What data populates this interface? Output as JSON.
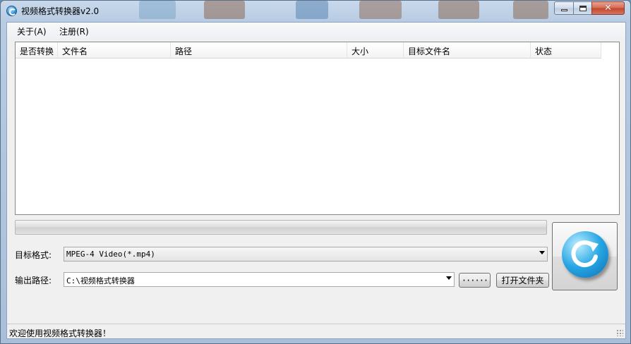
{
  "window": {
    "title": "视频格式转换器v2.0",
    "minimize_label": "",
    "maximize_label": "",
    "close_label": "✕"
  },
  "menu": {
    "about": "关于(A)",
    "register": "注册(R)"
  },
  "file_list": {
    "columns": [
      "是否转换",
      "文件名",
      "路径",
      "大小",
      "目标文件名",
      "状态"
    ],
    "rows": []
  },
  "progress": {
    "value": 0
  },
  "target_format": {
    "label": "目标格式:",
    "value": "MPEG-4 Video(*.mp4)"
  },
  "output_path": {
    "label": "输出路径:",
    "value": "C:\\视频格式转换器"
  },
  "buttons": {
    "browse": "······",
    "open_folder": "打开文件夹"
  },
  "status_bar": {
    "message": "欢迎使用视频格式转换器！"
  },
  "colors": {
    "title_bar": "#b7cbe2",
    "close_button": "#c2442b",
    "convert_icon": "#27a6e4"
  },
  "icons": {
    "app": "app-convert-icon",
    "convert": "convert-refresh-icon"
  }
}
